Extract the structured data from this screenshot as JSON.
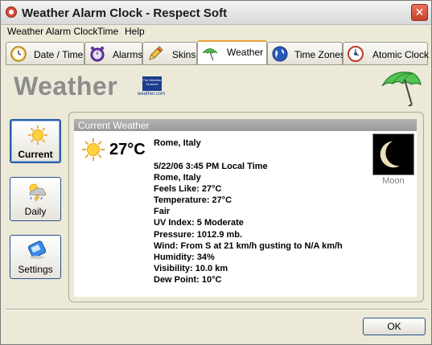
{
  "window": {
    "title": "Weather Alarm Clock - Respect Soft",
    "close_glyph": "✕"
  },
  "menu": [
    {
      "label": "Weather Alarm Clock"
    },
    {
      "label": "Time"
    },
    {
      "label": "Help"
    }
  ],
  "tabs": [
    {
      "label": "Date / Time",
      "icon": "clock-icon"
    },
    {
      "label": "Alarms",
      "icon": "alarm-icon"
    },
    {
      "label": "Skins",
      "icon": "pencil-icon"
    },
    {
      "label": "Weather",
      "icon": "umbrella-icon",
      "active": true
    },
    {
      "label": "Time Zones",
      "icon": "globe-icon"
    },
    {
      "label": "Atomic Clock",
      "icon": "atomic-clock-icon"
    }
  ],
  "header": {
    "title": "Weather",
    "logo_text": "The Weather Channel",
    "logo_caption": "weather.com"
  },
  "sidebar": [
    {
      "label": "Current",
      "icon": "sun-icon",
      "active": true
    },
    {
      "label": "Daily",
      "icon": "storm-cloud-icon"
    },
    {
      "label": "Settings",
      "icon": "settings-device-icon"
    }
  ],
  "current_weather": {
    "group_title": "Current Weather",
    "temperature": "27°C",
    "city": "Rome, Italy",
    "details": [
      "5/22/06 3:45 PM Local Time",
      "Rome, Italy",
      "Feels Like: 27°C",
      "Temperature: 27°C",
      "Fair",
      "UV Index: 5 Moderate",
      "Pressure: 1012.9 mb.",
      "Wind: From S at 21 km/h gusting to N/A km/h",
      "Humidity: 34%",
      "Visibility: 10.0 km",
      "Dew Point: 10°C"
    ],
    "moon_label": "Moon"
  },
  "footer": {
    "ok_label": "OK"
  },
  "colors": {
    "accent": "#e8a23a",
    "window_bg": "#ece9d8",
    "button_border": "#26508c"
  }
}
